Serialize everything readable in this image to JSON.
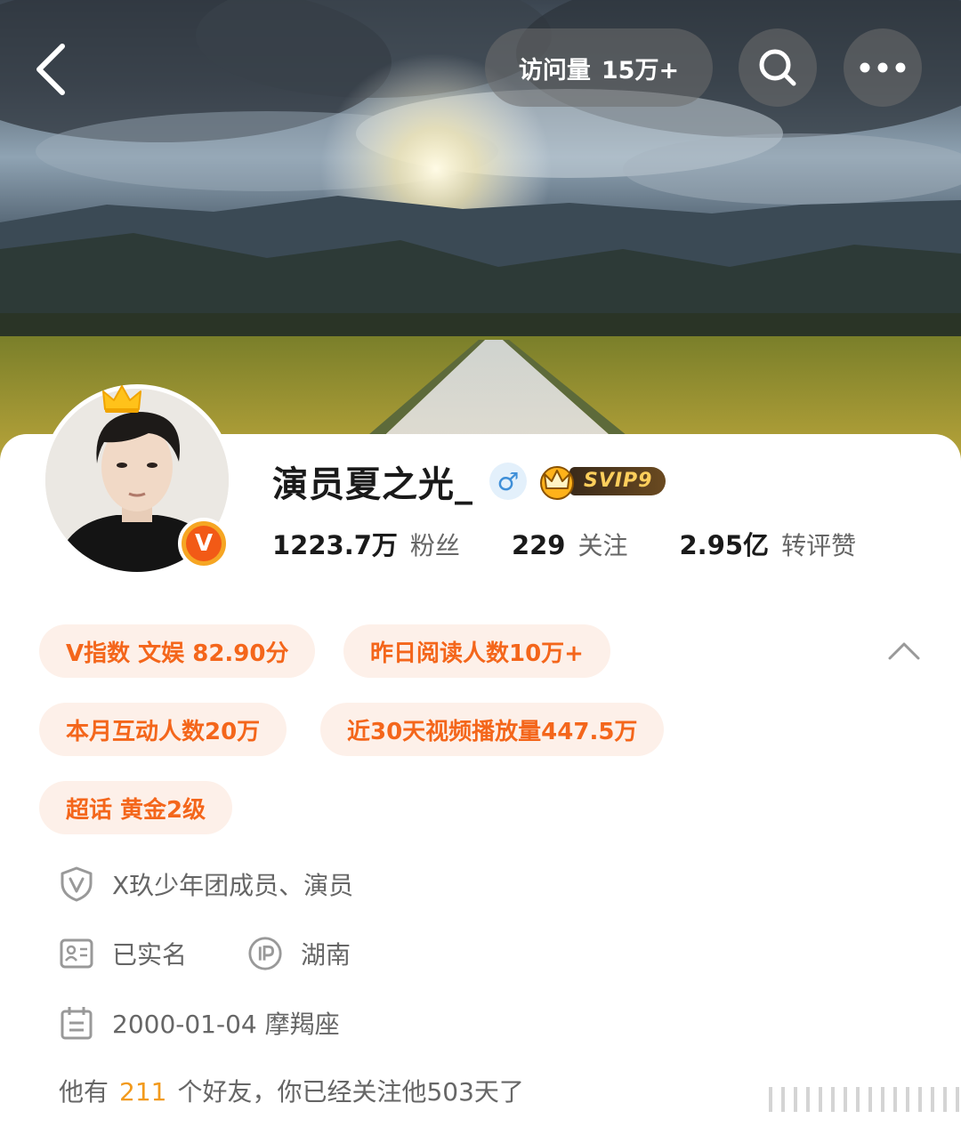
{
  "header": {
    "visits_label": "访问量",
    "visits_value": "15万+",
    "back_icon": "chevron-left-icon",
    "search_icon": "search-icon",
    "more_icon": "more-horizontal-icon"
  },
  "profile": {
    "name": "演员夏之光_",
    "gender_symbol": "♂",
    "vip_badge": "SVIP9",
    "verified_badge": "V",
    "stats": [
      {
        "value": "1223.7万",
        "label": "粉丝"
      },
      {
        "value": "229",
        "label": "关注"
      },
      {
        "value": "2.95亿",
        "label": "转评赞"
      }
    ]
  },
  "tags": [
    "V指数 文娱 82.90分",
    "昨日阅读人数10万+",
    "本月互动人数20万",
    "近30天视频播放量447.5万",
    "超话 黄金2级"
  ],
  "info": {
    "verification": "X玖少年团成员、演员",
    "realname": "已实名",
    "ip_location": "湖南",
    "birthday": "2000-01-04 摩羯座"
  },
  "friends": {
    "prefix": "他有",
    "count": "211",
    "suffix": "个好友，你已经关注他503天了"
  },
  "colors": {
    "accent": "#f4661b",
    "tag_bg": "#fdf0e9",
    "highlight": "#f29a1c"
  }
}
